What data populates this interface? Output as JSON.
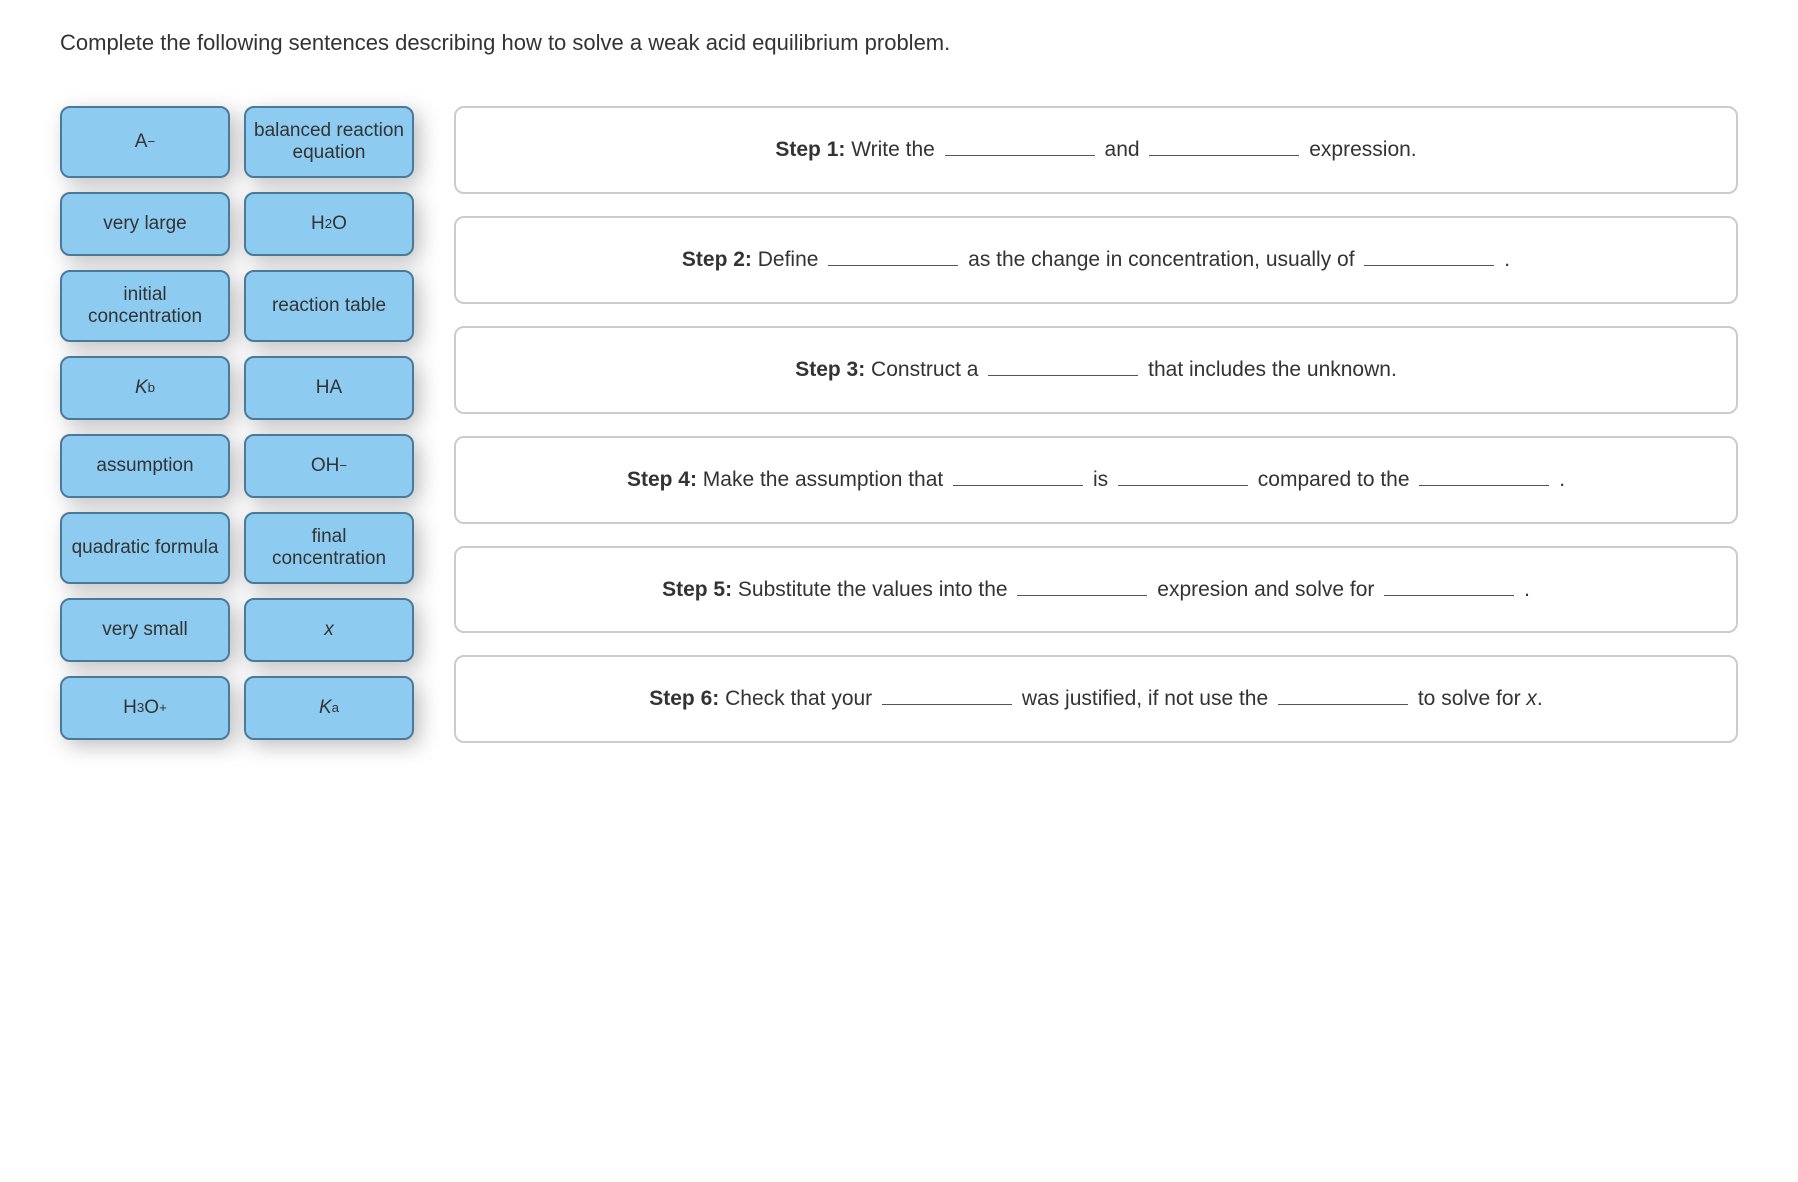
{
  "prompt": "Complete the following sentences describing how to solve a weak acid equilibrium problem.",
  "tiles": {
    "a_minus": "A⁻",
    "balanced_reaction_equation": "balanced reaction equation",
    "very_large": "very large",
    "h2o": "H₂O",
    "initial_concentration": "initial concentration",
    "reaction_table": "reaction table",
    "kb": "Kb",
    "ha": "HA",
    "assumption": "assumption",
    "oh_minus": "OH⁻",
    "quadratic_formula": "quadratic formula",
    "final_concentration": "final concentration",
    "very_small": "very small",
    "x": "x",
    "h3o_plus": "H₃O⁺",
    "ka": "Ka"
  },
  "steps": {
    "s1": {
      "label": "Step 1:",
      "t1": " Write the ",
      "t2": " and ",
      "t3": " expression."
    },
    "s2": {
      "label": "Step 2:",
      "t1": " Define ",
      "t2": " as the change in concentration, usually of ",
      "t3": " ."
    },
    "s3": {
      "label": "Step 3:",
      "t1": " Construct a ",
      "t2": " that includes the unknown."
    },
    "s4": {
      "label": "Step 4:",
      "t1": " Make the assumption that ",
      "t2": " is ",
      "t3": " compared to the ",
      "t4": " ."
    },
    "s5": {
      "label": "Step 5:",
      "t1": " Substitute the values into the ",
      "t2": " expresion and solve for ",
      "t3": " ."
    },
    "s6": {
      "label": "Step 6:",
      "t1": " Check that your ",
      "t2": " was justified, if not use the ",
      "t3": " to solve for ",
      "xvar": "x",
      "t4": "."
    }
  }
}
